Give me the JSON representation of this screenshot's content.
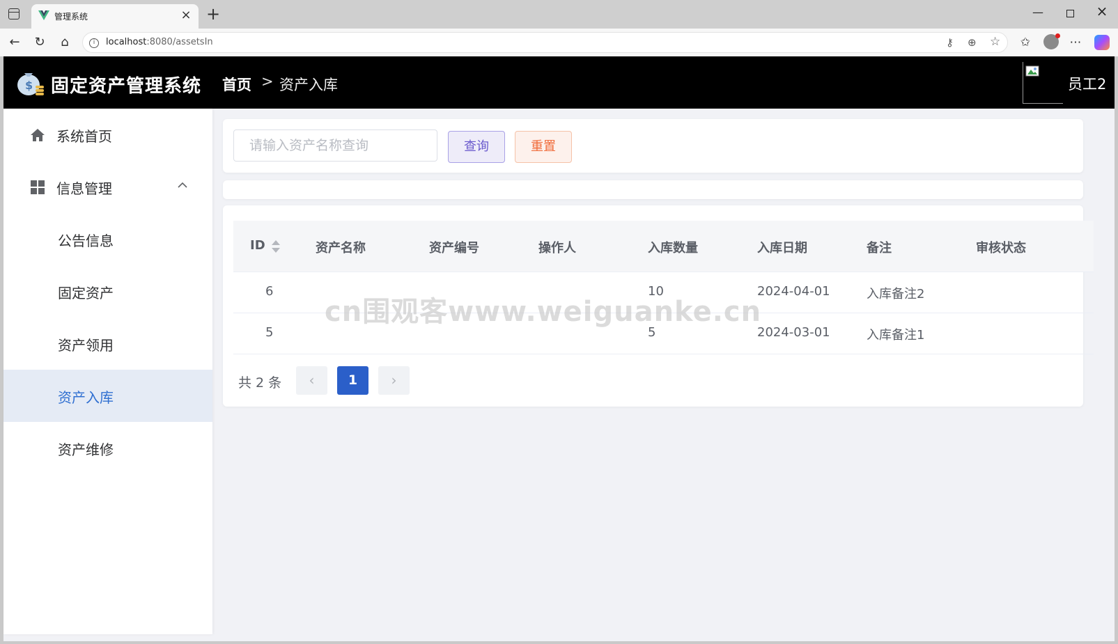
{
  "browser": {
    "tab_title": "管理系统",
    "url_host": "localhost",
    "url_rest": ":8080/assetsIn"
  },
  "header": {
    "system_title": "固定资产管理系统",
    "breadcrumb_home": "首页",
    "breadcrumb_sep": ">",
    "breadcrumb_current": "资产入库",
    "user_name": "员工2"
  },
  "sidebar": {
    "home": "系统首页",
    "group": "信息管理",
    "items": [
      "公告信息",
      "固定资产",
      "资产领用",
      "资产入库",
      "资产维修"
    ],
    "active_index": 3
  },
  "search": {
    "placeholder": "请输入资产名称查询",
    "query_label": "查询",
    "reset_label": "重置"
  },
  "table": {
    "columns": [
      "ID",
      "资产名称",
      "资产编号",
      "操作人",
      "入库数量",
      "入库日期",
      "备注",
      "审核状态"
    ],
    "rows": [
      {
        "id": "6",
        "name": "",
        "code": "",
        "operator": "",
        "qty": "10",
        "date": "2024-04-01",
        "remark": "入库备注2",
        "status": ""
      },
      {
        "id": "5",
        "name": "",
        "code": "",
        "operator": "",
        "qty": "5",
        "date": "2024-03-01",
        "remark": "入库备注1",
        "status": ""
      }
    ]
  },
  "pagination": {
    "total": "共 2 条",
    "current_page": "1",
    "prev_symbol": "‹",
    "next_symbol": "›"
  },
  "watermark": "cn围观客www.weiguanke.cn",
  "colors": {
    "header_bg": "#000000",
    "active_menu_bg": "#e5ebf5",
    "active_menu_text": "#2f6fd1",
    "page_button": "#2b5fc9",
    "query_button": "#6a5acd",
    "reset_button": "#f06c3b"
  }
}
